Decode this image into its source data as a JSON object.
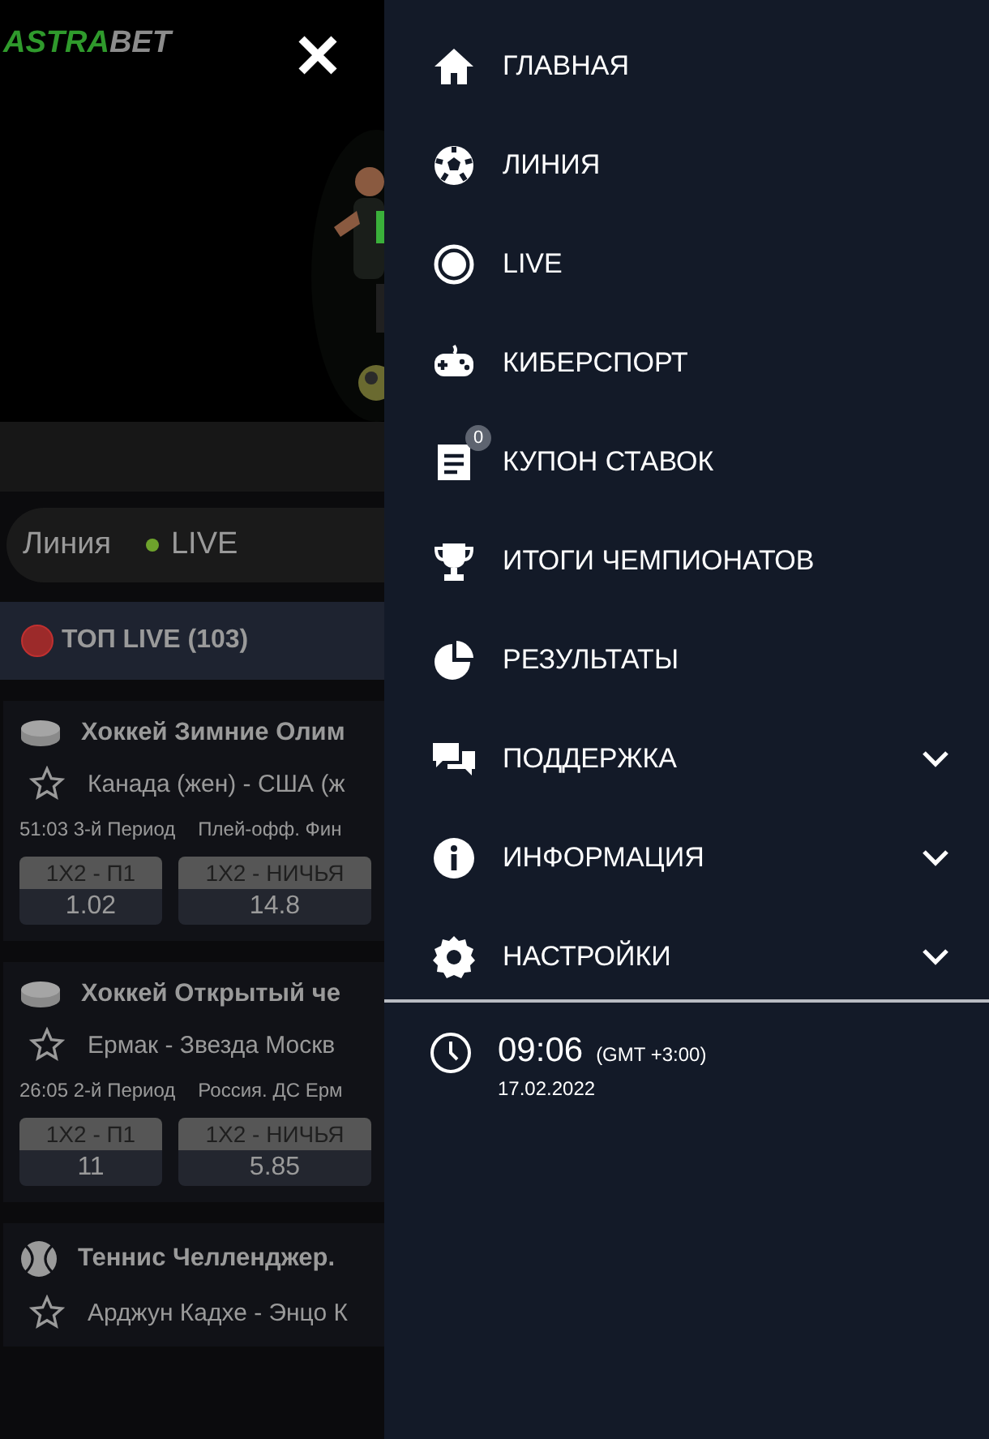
{
  "header": {
    "logo": {
      "brand": "ASTRA",
      "suffix": "BET"
    }
  },
  "tabs": [
    {
      "label": "Линия",
      "live_dot": false
    },
    {
      "label": "LIVE",
      "live_dot": true
    }
  ],
  "section": {
    "title": "ТОП LIVE (103)"
  },
  "events": [
    {
      "kind": "hockey",
      "league": "Хоккей Зимние Олим",
      "match": "Канада (жен) - США (ж",
      "clock": "51:03 3-й Период",
      "tournament": "Плей-офф. Фин",
      "odds": [
        {
          "label": "1X2 - П1",
          "value": "1.02"
        },
        {
          "label": "1X2 - НИЧЬЯ",
          "value": "14.8"
        }
      ]
    },
    {
      "kind": "hockey",
      "league": "Хоккей Открытый че",
      "match": "Ермак - Звезда Москв",
      "clock": "26:05 2-й Период",
      "tournament": "Россия. ДС Ерм",
      "odds": [
        {
          "label": "1X2 - П1",
          "value": "11"
        },
        {
          "label": "1X2 - НИЧЬЯ",
          "value": "5.85"
        }
      ]
    },
    {
      "kind": "tennis",
      "league": "Теннис Челленджер.",
      "match": "Арджун Кадхе - Энцо К"
    }
  ],
  "menu": {
    "items": [
      {
        "label": "ГЛАВНАЯ",
        "has_submenu": false
      },
      {
        "label": "ЛИНИЯ",
        "has_submenu": false
      },
      {
        "label": "LIVE",
        "has_submenu": false
      },
      {
        "label": "КИБЕРСПОРТ",
        "has_submenu": false
      },
      {
        "label": "КУПОН СТАВОК",
        "badge": "0",
        "has_submenu": false
      },
      {
        "label": "ИТОГИ ЧЕМПИОНАТОВ",
        "has_submenu": false
      },
      {
        "label": "РЕЗУЛЬТАТЫ",
        "has_submenu": false
      },
      {
        "label": "ПОДДЕРЖКА",
        "has_submenu": true
      },
      {
        "label": "ИНФОРМАЦИЯ",
        "has_submenu": true
      },
      {
        "label": "НАСТРОЙКИ",
        "has_submenu": true
      }
    ],
    "clock": {
      "time": "09:06",
      "zone": "(GMT +3:00)",
      "date": "17.02.2022"
    }
  }
}
